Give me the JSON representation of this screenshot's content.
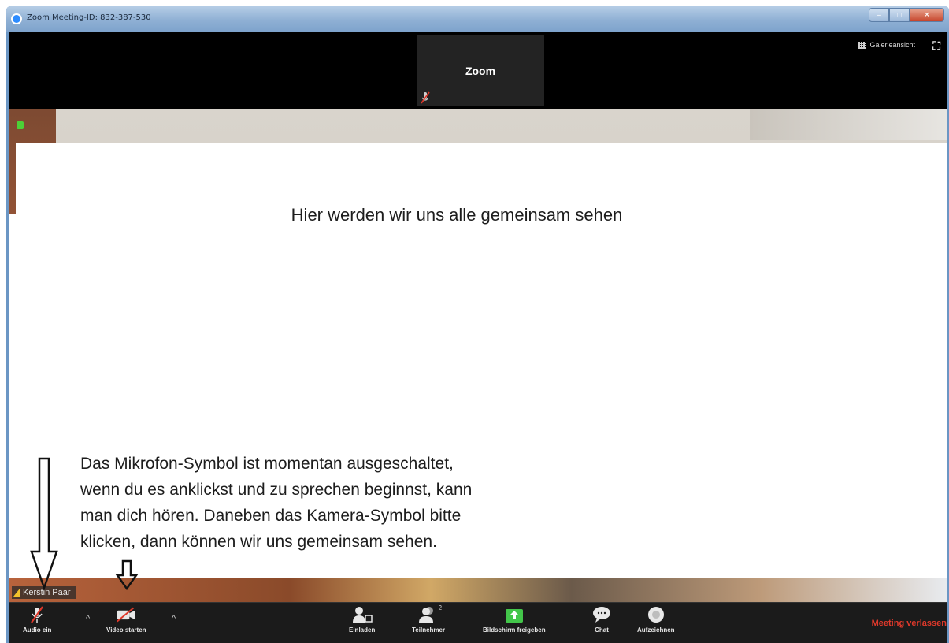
{
  "window": {
    "title": "Zoom Meeting-ID: 832-387-530",
    "controls": {
      "minimize": "–",
      "maximize": "□",
      "close": "✕"
    }
  },
  "top": {
    "thumbnail_name": "Zoom",
    "gallery_view_label": "Galerieansicht",
    "fullscreen_icon": "expand-icon"
  },
  "slide": {
    "headline": "Hier werden wir uns alle gemeinsam sehen",
    "instructions": [
      "Das Mikrofon-Symbol ist momentan ausgeschaltet,",
      "wenn du es anklickst und zu sprechen beginnst, kann",
      "man dich hören. Daneben das Kamera-Symbol bitte",
      "klicken, dann können wir uns gemeinsam sehen."
    ]
  },
  "participant_tag": "Kerstin Paar",
  "toolbar": {
    "audio_label": "Audio ein",
    "video_label": "Video starten",
    "invite_label": "Einladen",
    "participants_label": "Teilnehmer",
    "participants_count": "2",
    "share_label": "Bildschirm freigeben",
    "chat_label": "Chat",
    "record_label": "Aufzeichnen",
    "leave_label": "Meeting verlassen",
    "caret": "^"
  },
  "colors": {
    "leave_red": "#e0392b",
    "share_green": "#43c64a",
    "mute_red": "#e0392b",
    "toolbar_bg": "#1b1b1b"
  }
}
